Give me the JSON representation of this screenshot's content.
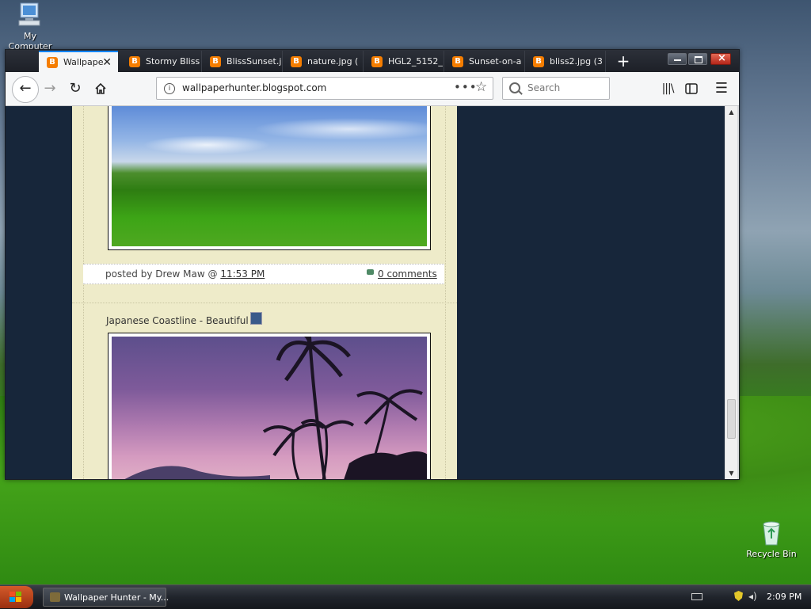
{
  "desktop": {
    "icons": [
      {
        "label": "My Computer"
      },
      {
        "label": "Recycle Bin"
      }
    ]
  },
  "browser": {
    "tabs": [
      {
        "label": "Wallpape",
        "active": true
      },
      {
        "label": "Stormy Bliss"
      },
      {
        "label": "BlissSunset.j"
      },
      {
        "label": "nature.jpg ("
      },
      {
        "label": "HGL2_5152_"
      },
      {
        "label": "Sunset-on-a"
      },
      {
        "label": "bliss2.jpg (3"
      }
    ],
    "url": "wallpaperhunter.blogspot.com",
    "search_placeholder": "Search"
  },
  "page": {
    "post1": {
      "posted_by": "posted by Drew Maw @ ",
      "time": "11:53 PM",
      "comments": "0 comments"
    },
    "post2": {
      "title": "Japanese Coastline - Beautiful"
    }
  },
  "taskbar": {
    "task_label": "Wallpaper Hunter - My...",
    "clock": "2:09 PM"
  },
  "colors": {
    "page_background": "#17263a",
    "post_column": "#eeebc9",
    "tab_accent": "#0a84ff",
    "blogger_orange": "#f57d00"
  }
}
